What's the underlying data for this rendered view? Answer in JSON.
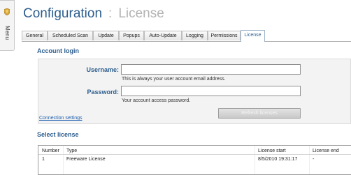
{
  "sidebar": {
    "icon": "shield-icon",
    "menu_label": "Menu"
  },
  "header": {
    "title": "Configuration",
    "separator": ":",
    "subtitle": "License"
  },
  "tabs": [
    {
      "label": "General",
      "active": false
    },
    {
      "label": "Scheduled Scan",
      "active": false
    },
    {
      "label": "Update",
      "active": false
    },
    {
      "label": "Popups",
      "active": false
    },
    {
      "label": "Auto-Update",
      "active": false
    },
    {
      "label": "Logging",
      "active": false
    },
    {
      "label": "Permissions",
      "active": false
    },
    {
      "label": "License",
      "active": true
    }
  ],
  "account_login": {
    "heading": "Account login",
    "username": {
      "label": "Username:",
      "value": "",
      "hint": "This is always your user account email address."
    },
    "password": {
      "label": "Password:",
      "value": "",
      "hint": "Your account access password."
    },
    "connection_settings_link": "Connection settings",
    "refresh_button": "Refresh licenses"
  },
  "select_license": {
    "heading": "Select license",
    "columns": [
      "Number",
      "Type",
      "License start",
      "License end"
    ],
    "rows": [
      [
        "1",
        "Freeware License",
        "8/5/2010 19:31:17",
        "-"
      ]
    ]
  },
  "colors": {
    "accent": "#2d5e8e",
    "link": "#1f5fae",
    "panel_background": "#f3f3f3"
  }
}
